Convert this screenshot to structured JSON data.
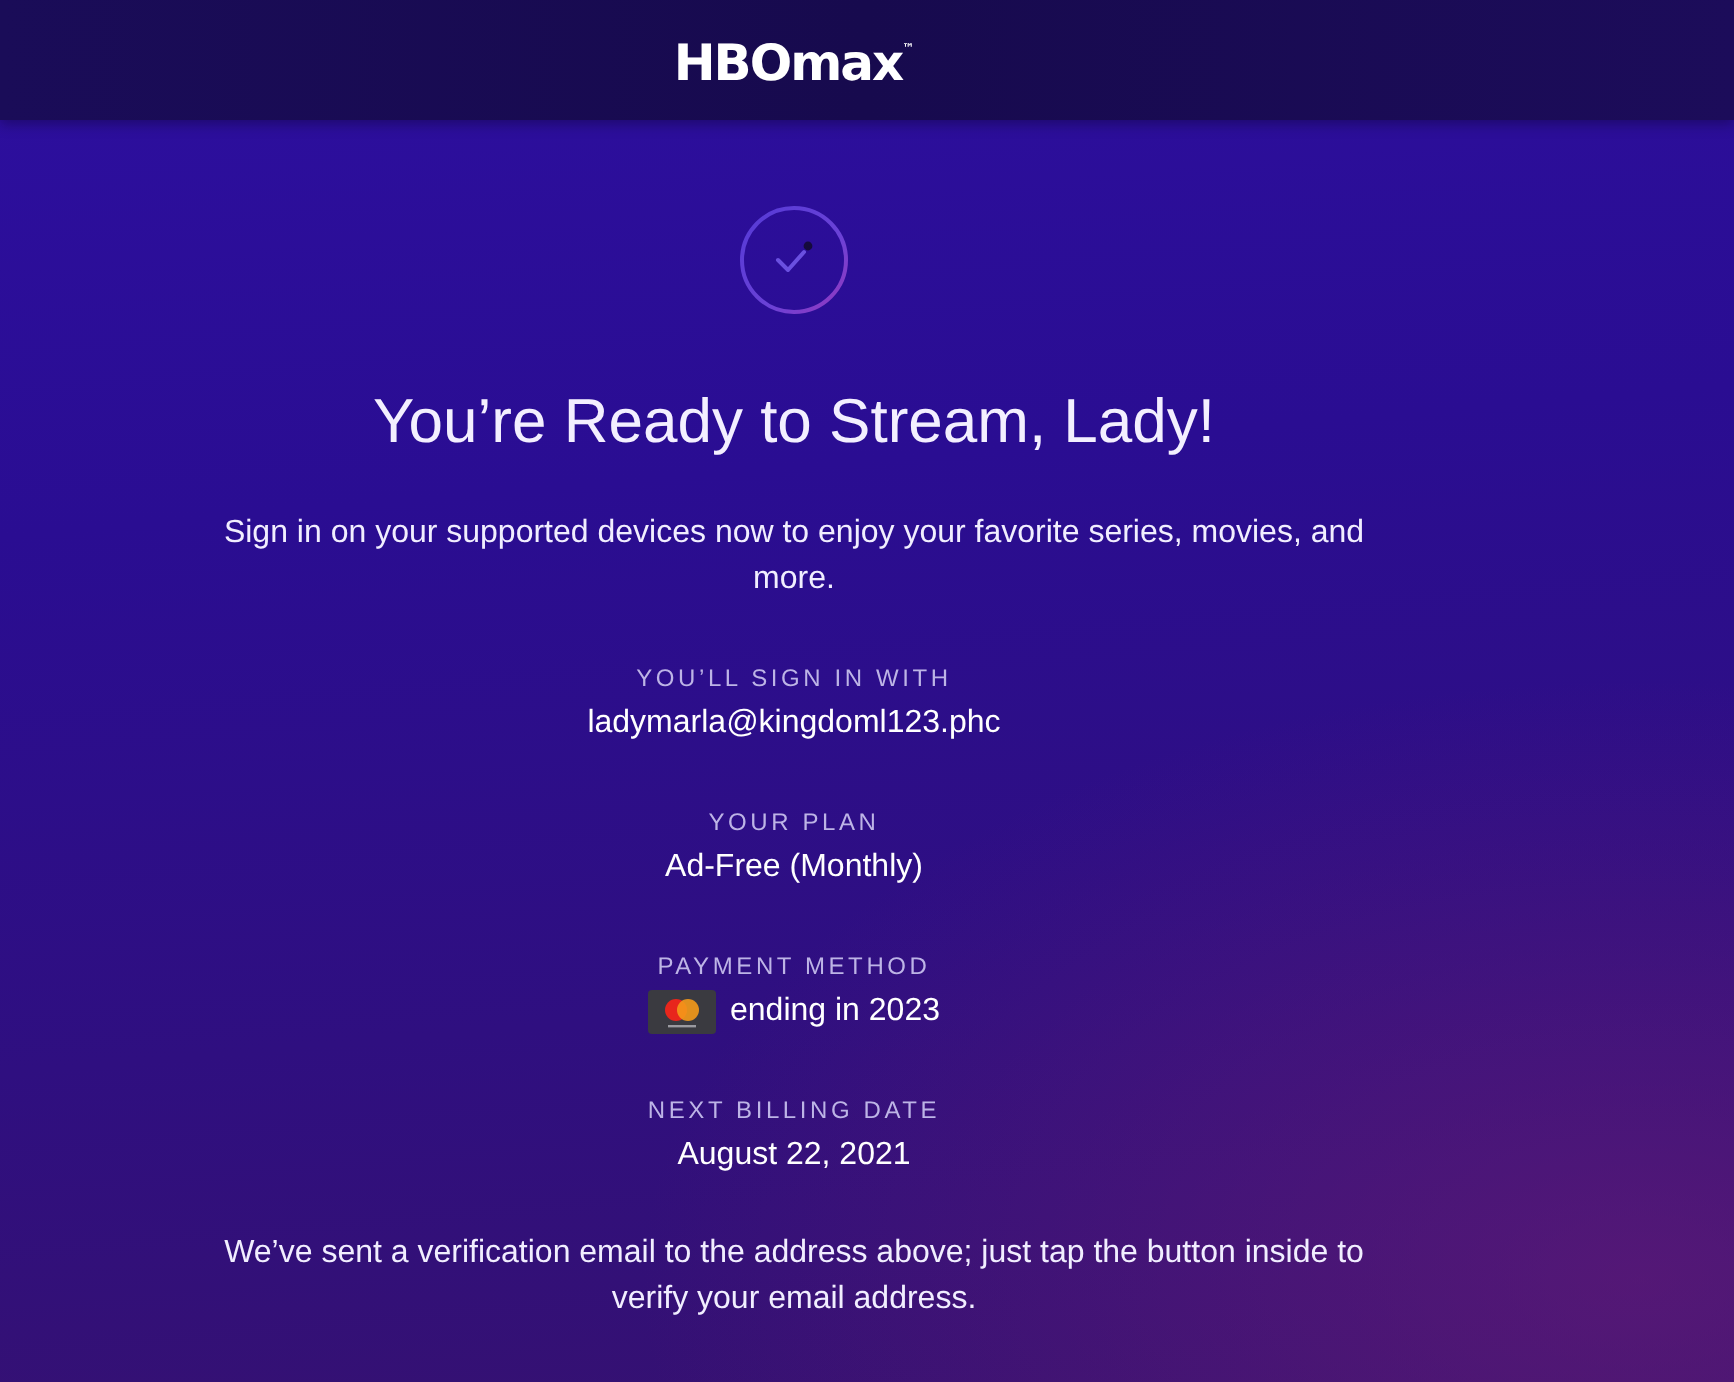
{
  "header": {
    "logo": "HBOmax$^{™}$"
  },
  "heading": "You’re Ready to Stream, Lady!",
  "intro": "Sign in on your supported devices now to enjoy your favorite series, movies, and more.",
  "details": [
    {
      "kind": "text",
      "label": "YOU’LL SIGN IN WITH",
      "value": "ladymarla@kingdoml123.phc"
    },
    {
      "kind": "text",
      "label": "YOUR PLAN",
      "value": "Ad-Free (Monthly)"
    },
    {
      "kind": "card",
      "label": "PAYMENT METHOD",
      "value": "ending in 2023"
    },
    {
      "kind": "text",
      "label": "NEXT BILLING DATE",
      "value": "August 22, 2021"
    }
  ],
  "note": "We’ve sent a verification email to the address above; just tap the button inside to verify your email address."
}
